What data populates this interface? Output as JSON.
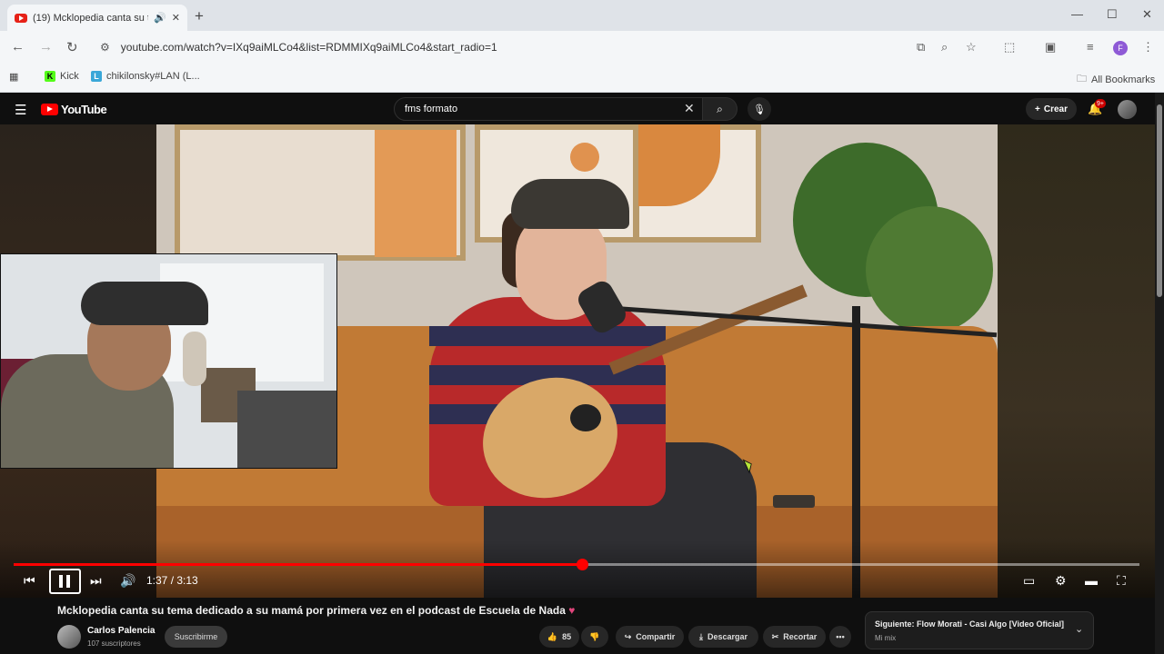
{
  "browser": {
    "tab_title": "(19) Mcklopedia canta su te",
    "url": "youtube.com/watch?v=IXq9aiMLCo4&list=RDMMIXq9aiMLCo4&start_radio=1",
    "profile_initial": "F",
    "bookmarks": [
      {
        "label": "Kick",
        "icon": "kick-icon"
      },
      {
        "label": "chikilonsky#LAN (L...",
        "icon": "l-icon"
      }
    ],
    "all_bookmarks": "All Bookmarks"
  },
  "youtube": {
    "logo_text": "YouTube",
    "search_value": "fms formato",
    "create_label": "Crear",
    "notification_badge": "9+"
  },
  "player": {
    "progress": 0.505,
    "time": "1:37 / 3:13",
    "state": "playing"
  },
  "video": {
    "title": "Mcklopedia canta su tema dedicado a su mamá por primera vez en el podcast de Escuela de Nada",
    "title_emoji": "♥",
    "channel": "Carlos Palencia",
    "subscribers": "107 suscriptores",
    "subscribe_label": "Suscribirme",
    "likes": "85",
    "share_label": "Compartir",
    "download_label": "Descargar",
    "clip_label": "Recortar",
    "more_label": "•••"
  },
  "next_up": {
    "title": "Siguiente: Flow Morati - Casi Algo [Video Oficial]",
    "subtitle": "Mi mix"
  }
}
